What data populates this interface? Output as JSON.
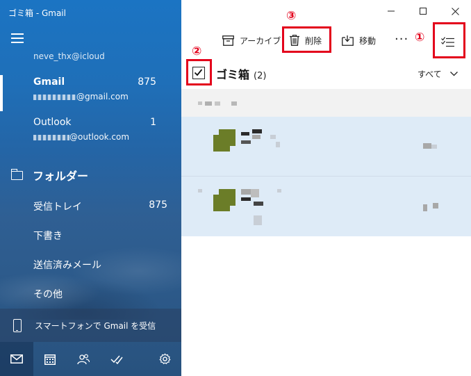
{
  "window": {
    "title": "ゴミ箱 - Gmail"
  },
  "sidebar": {
    "partial_account": "neve_thx@icloud",
    "accounts": [
      {
        "name": "Gmail",
        "count": "875",
        "email_suffix": "@gmail.com",
        "active": true
      },
      {
        "name": "Outlook",
        "count": "1",
        "email_suffix": "@outlook.com",
        "active": false
      }
    ],
    "folders_heading": "フォルダー",
    "folders": [
      {
        "label": "受信トレイ",
        "count": "875"
      },
      {
        "label": "下書き",
        "count": ""
      },
      {
        "label": "送信済みメール",
        "count": ""
      },
      {
        "label": "その他",
        "count": ""
      }
    ],
    "phone_promo": "スマートフォンで Gmail を受信",
    "bottom_nav": [
      "mail-icon",
      "calendar-icon",
      "people-icon",
      "todo-icon",
      "gear-icon"
    ]
  },
  "toolbar": {
    "archive_label": "アーカイブ",
    "delete_label": "削除",
    "move_label": "移動",
    "more_label": "···"
  },
  "annotations": {
    "marker_1": "①",
    "marker_2": "②",
    "marker_3": "③",
    "highlight_color": "#e3001b"
  },
  "list": {
    "folder_title": "ゴミ箱",
    "folder_count": "(2)",
    "filter_label": "すべて"
  },
  "colors": {
    "sidebar_blue": "#1f6fb8",
    "selected_row": "#deebf7",
    "avatar": "#6b7d28"
  }
}
